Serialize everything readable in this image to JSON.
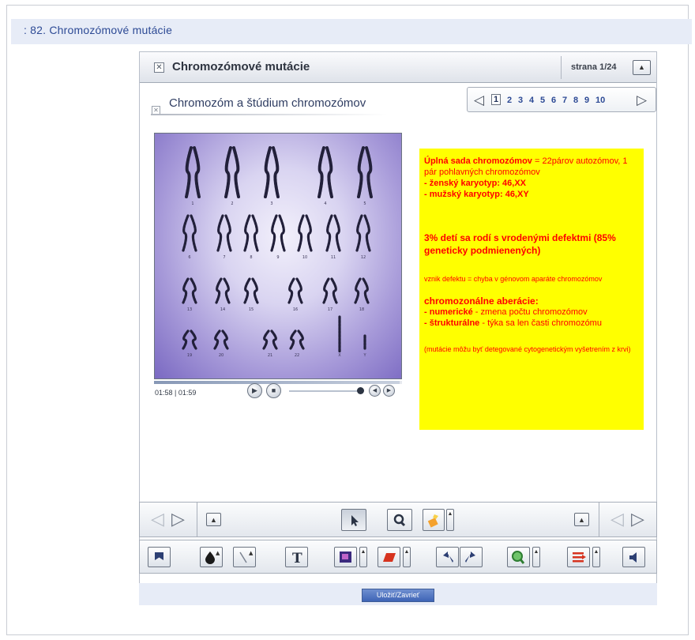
{
  "page": {
    "title": ": 82. Chromozómové mutácie"
  },
  "player": {
    "header_title": "Chromozómové mutácie",
    "page_label": "strana  1/24",
    "subtitle": "Chromozóm a štúdium chromozómov",
    "pager": {
      "pages": [
        "1",
        "2",
        "3",
        "4",
        "5",
        "6",
        "7",
        "8",
        "9",
        "10"
      ],
      "active": "1"
    },
    "video": {
      "time": "01:58 | 01:59",
      "progress_fraction": 0.99,
      "volume_fraction": 0.92,
      "karyotype_labels": [
        "1",
        "2",
        "3",
        "4",
        "5",
        "6",
        "7",
        "8",
        "9",
        "10",
        "11",
        "12",
        "13",
        "14",
        "15",
        "16",
        "17",
        "18",
        "19",
        "20",
        "21",
        "22",
        "X",
        "Y"
      ]
    },
    "notes": {
      "heading": "Úplná sada chromozómov",
      "heading_rest": " = 22párov autozómov, 1 pár pohlavných chromozómov",
      "female": " - ženský karyotyp: 46,XX",
      "male": " - mužský karyotyp: 46,XY",
      "defects": "3% detí sa rodí s vrodenými defektmi (85% geneticky podmienených)",
      "origin": "vznik defektu = chyba v génovom aparáte chromozómov",
      "aberrations_heading": "chromozonálne aberácie:",
      "numeric_term": " - numerické",
      "numeric_desc": " - zmena počtu chromozómov",
      "structural_term": " - štrukturálne",
      "structural_desc": " - týka sa len časti chromozómu",
      "detection": "(mutácie môžu byť detegované cytogenetickým vyšetrením z krvi)"
    }
  },
  "footer": {
    "save_label": "Uložiť/Zavrieť"
  },
  "colors": {
    "notes_background": "#ffff00",
    "notes_text": "#ff0000",
    "accent_blue": "#2d4a95"
  },
  "icons": {
    "toolbar1": [
      "prev-icon",
      "next-icon",
      "collapse-icon",
      "pointer-icon",
      "zoom-icon",
      "highlighter-icon",
      "collapse-icon",
      "prev-icon",
      "next-icon"
    ],
    "toolbar2": [
      "bookmark-icon",
      "ink-drop-icon",
      "line-icon",
      "text-icon",
      "frame-icon",
      "eraser-icon",
      "undo-icon",
      "redo-icon",
      "zoom-in-icon",
      "list-icon",
      "speaker-icon"
    ]
  }
}
